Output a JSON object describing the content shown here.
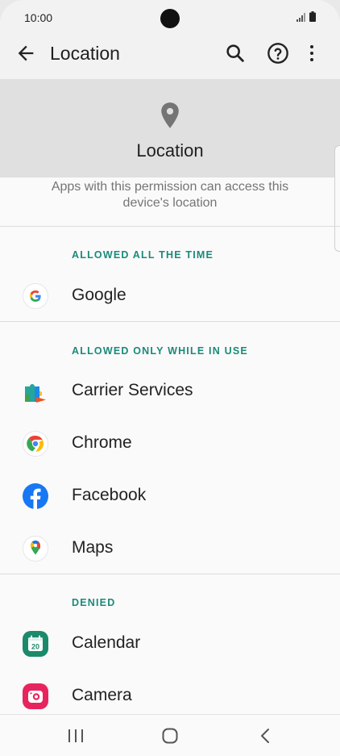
{
  "status_bar": {
    "time": "10:00"
  },
  "app_bar": {
    "title": "Location"
  },
  "header": {
    "title": "Location",
    "description": "Apps with this permission can access this device's location"
  },
  "sections": [
    {
      "title": "ALLOWED ALL THE TIME",
      "apps": [
        {
          "name": "Google",
          "icon": "google-icon"
        }
      ]
    },
    {
      "title": "ALLOWED ONLY WHILE IN USE",
      "apps": [
        {
          "name": "Carrier Services",
          "icon": "carrier-services-icon"
        },
        {
          "name": "Chrome",
          "icon": "chrome-icon"
        },
        {
          "name": "Facebook",
          "icon": "facebook-icon"
        },
        {
          "name": "Maps",
          "icon": "maps-icon"
        }
      ]
    },
    {
      "title": "DENIED",
      "apps": [
        {
          "name": "Calendar",
          "icon": "calendar-icon"
        },
        {
          "name": "Camera",
          "icon": "camera-icon"
        }
      ]
    }
  ],
  "calendar_icon_day": "20",
  "colors": {
    "section_header": "#1a8a7a",
    "header_band": "#e0e0e0",
    "app_bar": "#f2f2f2"
  }
}
